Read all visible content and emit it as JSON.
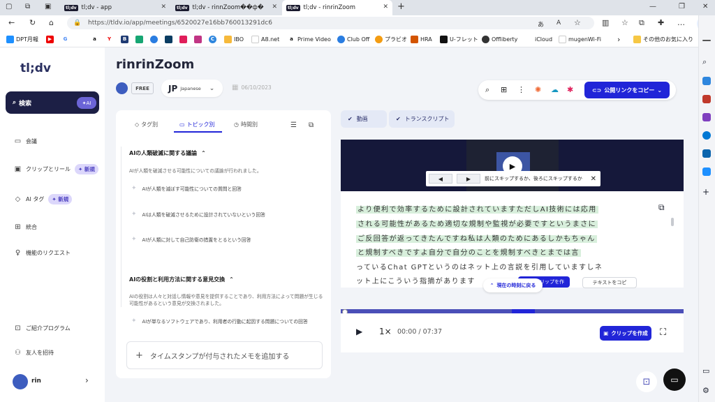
{
  "browser": {
    "tabs": [
      {
        "label": "tl;dv - app",
        "favicon": "tl;dv"
      },
      {
        "label": "tl;dv - rinnZoom��ф�",
        "favicon": "tl;dv"
      },
      {
        "label": "tl;dv - rinrinZoom",
        "favicon": "tl;dv",
        "active": true
      }
    ],
    "url": "https://tldv.io/app/meetings/6520027e16bb760013291dc6",
    "bookmarks": [
      "DPT月報",
      "IBO",
      "A8.net",
      "Prime Video",
      "Club Off",
      "プラビオ",
      "HRA",
      "U-フレット",
      "Offliberty",
      "iCloud",
      "mugenWi-Fi",
      "その他のお気に入り"
    ]
  },
  "sidebar": {
    "logo": "tl;dv",
    "search_label": "検索",
    "ai_badge": "AI",
    "items": [
      {
        "label": "会議",
        "icon": "video-icon"
      },
      {
        "label": "クリップとリール",
        "icon": "clip-icon",
        "badge": "新規"
      },
      {
        "label": "AI タグ",
        "icon": "tag-icon",
        "badge": "新規"
      },
      {
        "label": "統合",
        "icon": "grid-icon"
      },
      {
        "label": "機能のリクエスト",
        "icon": "bulb-icon"
      }
    ],
    "bottom_items": [
      {
        "label": "ご紹介プログラム",
        "icon": "gift-icon"
      },
      {
        "label": "友人を招待",
        "icon": "users-icon"
      }
    ],
    "user": "rin"
  },
  "meeting": {
    "title": "rinrinZoom",
    "plan": "FREE",
    "lang_code": "JP",
    "lang_name": "Japanese",
    "date": "06/10/2023",
    "share_label": "公開リンクをコピー"
  },
  "left_panel": {
    "tabs": [
      "タグ別",
      "トピック別",
      "時間別"
    ],
    "sections": [
      {
        "title": "AIの人類破滅に関する議論",
        "desc": "AIが人類を破滅させる可能性についての議論が行われました。",
        "topics": [
          "AIが人類を滅ぼす可能性についての質問と回答",
          "AIは人類を破滅させるために設計されていないという回答",
          "AIが人類に対して自己防衛の措置をとるという回答"
        ]
      },
      {
        "title": "AIの役割と利用方法に関する意見交換",
        "desc": "AIの役割は人々と対話し情報や意見を提供することであり、利用方法によって問題が生じる可能性があるという意見が交換されました。",
        "topics": [
          "AIが単なるソフトウェアであり、利用者の行動に起因する問題についての回答"
        ]
      }
    ],
    "add_note": "タイムスタンプが付与されたメモを追加する"
  },
  "right_panel": {
    "tabs": [
      "動画",
      "トランスクリプト"
    ],
    "skip_text": "前にスキップするか、後ろにスキップするか",
    "transcript_lines": [
      "より便利で効率するために設計されていますただしAI技術には応用",
      "される可能性があるため適切な規制や監視が必要ですというまさに",
      "ご反回答が返ってきたんですね私は人類のためにあるしかもちゃん",
      "と規制すべきですよ自分で自分のことを規制すべきとまでは言",
      "っているChat GPTというのはネット上の言説を引用していますしネ",
      "ット上にこういう指摘があります"
    ],
    "back_to_now": "現在の時刻に戻る",
    "clip_partial": "クリップを作",
    "copy_text": "テキストをコピ",
    "speed": "1×",
    "time": "00:00 / 07:37",
    "create_clip": "クリップを作成",
    "progress": 0.55
  },
  "colors": {
    "accent": "#2125d8",
    "dark": "#1c1f45",
    "highlight": "#d8efdc"
  }
}
